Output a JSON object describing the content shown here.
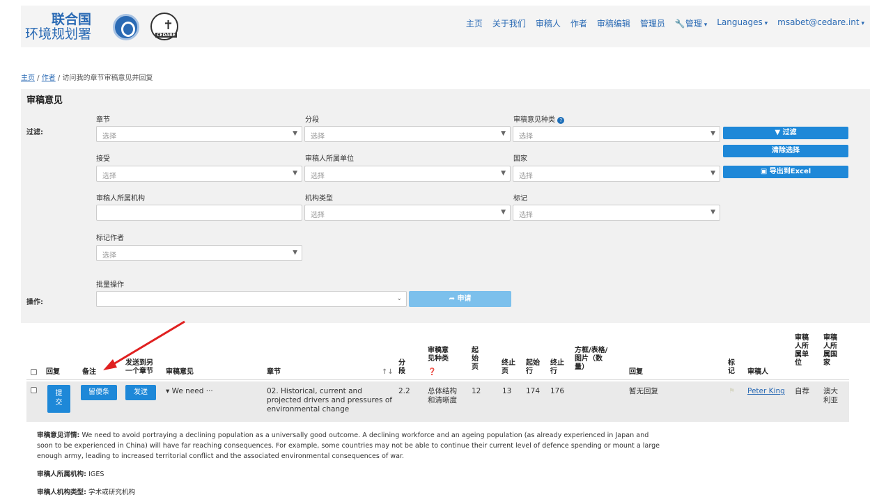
{
  "header": {
    "logo_line1": "联合国",
    "logo_line2": "环境规划署",
    "cedare_label": "CEDARE",
    "nav": [
      "主页",
      "关于我们",
      "审稿人",
      "作者",
      "审稿编辑",
      "管理员"
    ],
    "nav_manage": "管理",
    "nav_languages": "Languages",
    "nav_user": "msabet@cedare.int"
  },
  "breadcrumb": {
    "home": "主页",
    "authors": "作者",
    "current": "访问我的章节审稿意见并回复"
  },
  "panel": {
    "title": "审稿意见",
    "filter_label": "过滤:",
    "action_label": "操作:",
    "fields": {
      "chapter": "章节",
      "section": "分段",
      "comment_type": "审稿意见种类",
      "accepted": "接受",
      "reviewer_unit": "审稿人所属单位",
      "country": "国家",
      "reviewer_org": "审稿人所属机构",
      "org_type": "机构类型",
      "flag": "标记",
      "flag_author": "标记作者",
      "bulk": "批量操作"
    },
    "placeholder": "选择",
    "btn_filter": "过滤",
    "btn_clear": "清除选择",
    "btn_export": "导出到Excel",
    "btn_apply": "申请"
  },
  "table": {
    "headers": {
      "reply": "回复",
      "notes": "备注",
      "send": "发送到另\n一个章节",
      "comment": "审稿意见",
      "chapter": "章节",
      "section": "分\n段",
      "type": "审稿意\n见种类",
      "start_page": "起\n始\n页",
      "end_page": "终止\n页",
      "start_line": "起始\n行",
      "end_line": "终止\n行",
      "box": "方框/表格/\n图片（数\n量）",
      "answer": "回复",
      "flag": "标\n记",
      "reviewer": "审稿人",
      "unit": "审稿\n人所\n属单\n位",
      "country": "审稿\n人所\n属国\n家"
    },
    "row": {
      "submit": "提\n交",
      "note_btn": "留便条",
      "send_btn": "发送",
      "comment": "▾ We need ···",
      "chapter": "02. Historical, current and projected drivers and pressures of environmental change",
      "section": "2.2",
      "type": "总体结构\n和清晰度",
      "start_page": "12",
      "end_page": "13",
      "start_line": "174",
      "end_line": "176",
      "answer": "暂无回复",
      "reviewer": "Peter King",
      "unit": "自荐",
      "country": "澳大\n利亚"
    }
  },
  "details": {
    "comment_label": "审稿意见详情:",
    "comment_text": " We need to avoid portraying a declining population as a universally good outcome. A declining workforce and an ageing population (as already experienced in Japan and soon to be experienced in China) will have far reaching consequences. For example, some countries may not be able to continue their current level of defence spending or mount a large enough army, leading to increased territorial conflict and the associated environmental consequences of war.",
    "org_label": "审稿人所属机构:",
    "org_value": " IGES",
    "org_type_label": "审稿人机构类型:",
    "org_type_value": " 学术或研究机构"
  },
  "colors": {
    "accent": "#1e88d8",
    "link": "#2a6ab4",
    "arrow": "#e02020"
  }
}
